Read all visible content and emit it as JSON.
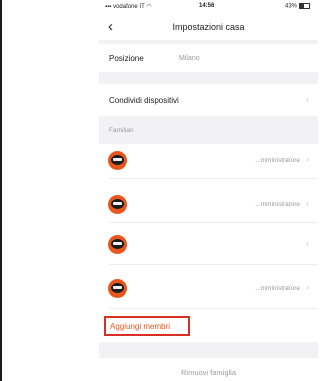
{
  "status_bar": {
    "carrier": "vodafone IT",
    "time": "14:56",
    "battery": "43%"
  },
  "nav": {
    "back_glyph": "‹",
    "title": "Impostazioni casa"
  },
  "location": {
    "label": "Posizione",
    "value": "Milano"
  },
  "share": {
    "label": "Condividi dispositivi"
  },
  "family_section": {
    "label": "Familiari"
  },
  "members": [
    {
      "role": "...mministratore"
    },
    {
      "role": "...mministratore"
    },
    {
      "role": ""
    },
    {
      "role": "...mministratore"
    }
  ],
  "add_members": {
    "label": "Aggiungi membri",
    "accent": "#e8561d",
    "highlight": "#d93025"
  },
  "remove_family": {
    "label": "Rimuovi famiglia"
  },
  "chevron": "›"
}
